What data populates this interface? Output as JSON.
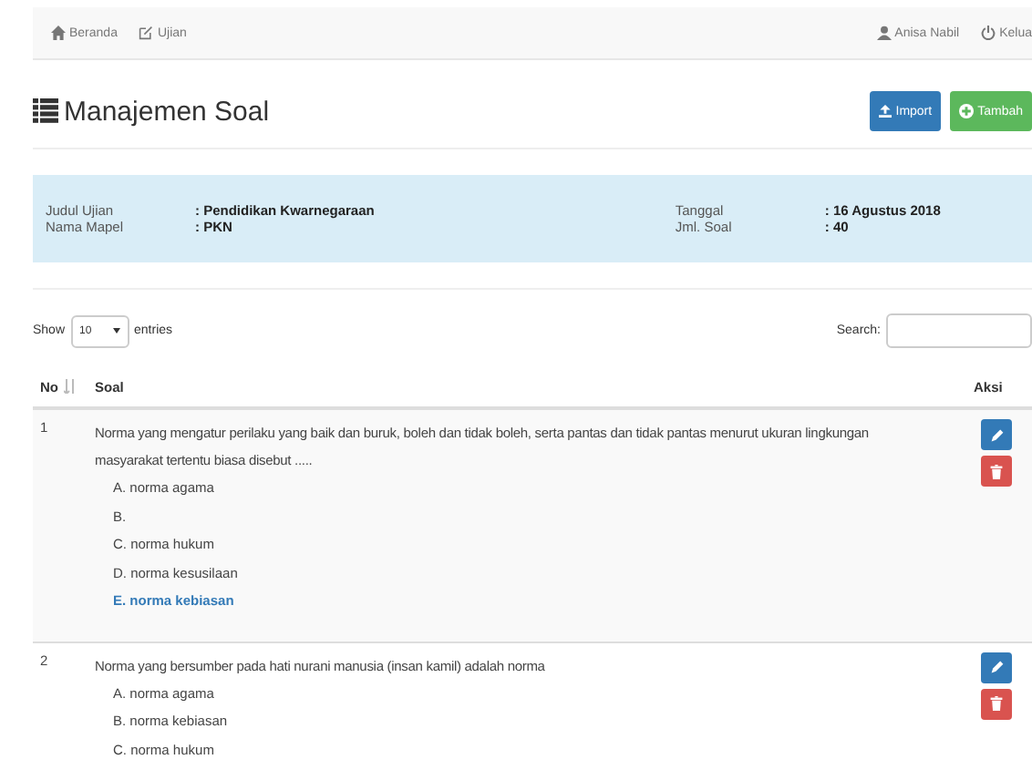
{
  "navbar": {
    "left": [
      {
        "label": "Beranda",
        "kind": "home"
      },
      {
        "label": "Ujian",
        "kind": "edit"
      }
    ],
    "right": [
      {
        "label": "Anisa Nabil",
        "kind": "user"
      },
      {
        "label": "Kelua",
        "kind": "power"
      }
    ]
  },
  "page_title": "Manajemen Soal",
  "buttons": [
    {
      "label": "Import",
      "kind": "import"
    },
    {
      "label": "Tambah",
      "kind": "add"
    }
  ],
  "info": {
    "left": [
      {
        "label": "Judul Ujian",
        "value": ": Pendidikan Kwarnegaraan"
      },
      {
        "label": "Nama Mapel",
        "value": ": PKN"
      }
    ],
    "right": [
      {
        "label": "Tanggal",
        "value": ": 16 Agustus 2018"
      },
      {
        "label": "Jml. Soal",
        "value": ": 40"
      }
    ]
  },
  "length_control": {
    "before": "Show",
    "value": "10",
    "after": "entries"
  },
  "search": {
    "label": "Search:"
  },
  "table": {
    "columns": [
      "No",
      "Soal",
      "Aksi"
    ],
    "rows": [
      {
        "no": "1",
        "question": "Norma yang mengatur perilaku yang baik dan buruk, boleh dan tidak boleh, serta pantas dan tidak pantas menurut ukuran lingkungan masyarakat tertentu biasa disebut .....",
        "options": [
          {
            "text": "A. norma agama",
            "correct": false
          },
          {
            "text": "B.",
            "correct": false
          },
          {
            "text": "C. norma hukum",
            "correct": false
          },
          {
            "text": "D. norma kesusilaan",
            "correct": false
          },
          {
            "text": "E. norma kebiasan",
            "correct": true
          }
        ]
      },
      {
        "no": "2",
        "question": "Norma yang bersumber pada hati nurani manusia (insan kamil) adalah norma",
        "options": [
          {
            "text": "A. norma agama",
            "correct": false
          },
          {
            "text": "B. norma kebiasan",
            "correct": false
          },
          {
            "text": "C. norma hukum",
            "correct": false
          }
        ]
      }
    ]
  }
}
